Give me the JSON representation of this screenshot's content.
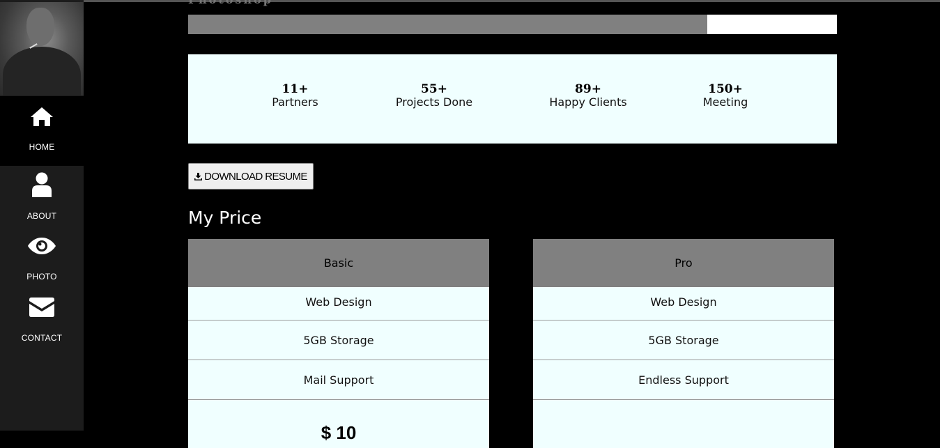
{
  "sidebar": {
    "items": [
      {
        "label": "HOME",
        "icon": "home-icon",
        "active": true
      },
      {
        "label": "ABOUT",
        "icon": "user-icon",
        "active": false
      },
      {
        "label": "PHOTO",
        "icon": "eye-icon",
        "active": false
      },
      {
        "label": "CONTACT",
        "icon": "envelope-icon",
        "active": false
      }
    ]
  },
  "skill": {
    "label": "Photoshop",
    "percent": 80
  },
  "stats": [
    {
      "number": "11+",
      "label": "Partners"
    },
    {
      "number": "55+",
      "label": "Projects Done"
    },
    {
      "number": "89+",
      "label": "Happy Clients"
    },
    {
      "number": "150+",
      "label": "Meeting"
    }
  ],
  "download": {
    "label": "DOWNLOAD RESUME",
    "icon": "download-icon"
  },
  "pricing": {
    "title": "My Price",
    "plans": [
      {
        "name": "Basic",
        "features": [
          "Web Design",
          "5GB Storage",
          "Mail Support"
        ],
        "price": "$ 10"
      },
      {
        "name": "Pro",
        "features": [
          "Web Design",
          "5GB Storage",
          "Endless Support"
        ],
        "price": ""
      }
    ]
  },
  "colors": {
    "background": "#000000",
    "sidebar": "#1c1c1c",
    "panel": "#f0ffff",
    "bar": "#808080"
  }
}
